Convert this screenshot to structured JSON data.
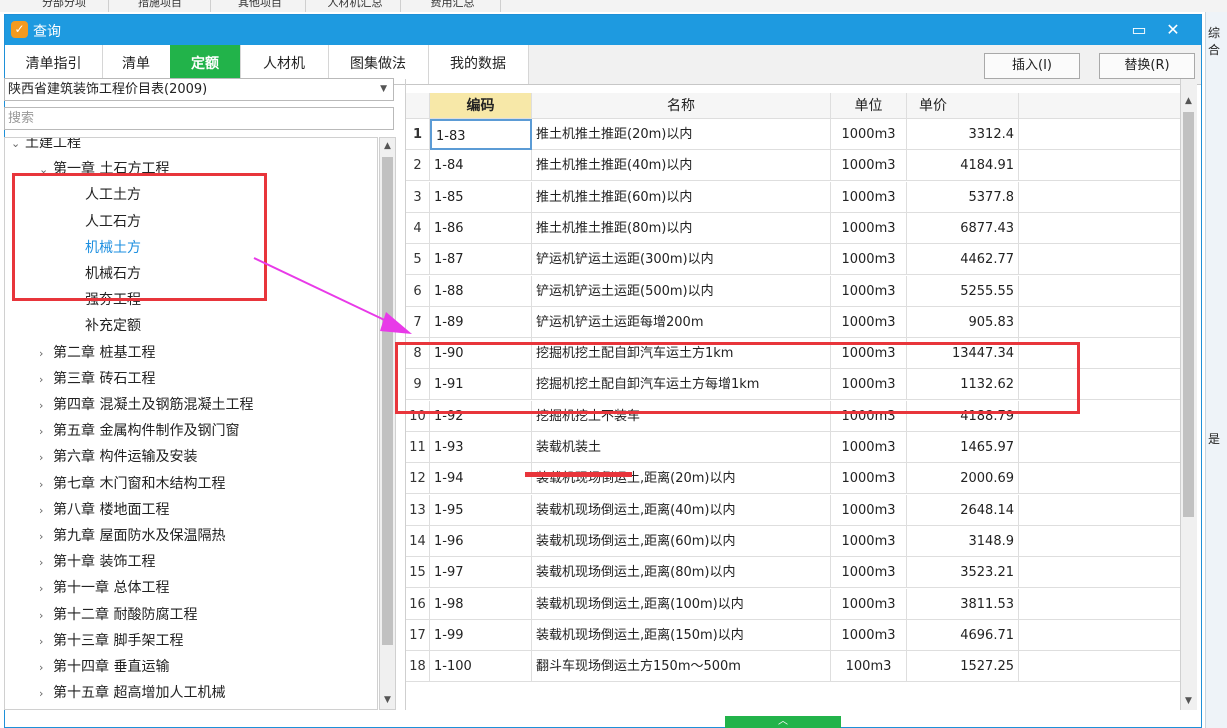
{
  "background": {
    "tabs": [
      "分部分项",
      "措施项目",
      "其他项目",
      "人材机汇总",
      "费用汇总"
    ],
    "right_cut_top": "综合",
    "right_cut_mid": "是"
  },
  "dialog": {
    "title": "查询",
    "minimize_icon": "minimize-icon",
    "close_icon": "close-icon",
    "tabs": [
      {
        "label": "清单指引",
        "active": false
      },
      {
        "label": "清单",
        "active": false
      },
      {
        "label": "定额",
        "active": true
      },
      {
        "label": "人材机",
        "active": false
      },
      {
        "label": "图集做法",
        "active": false
      },
      {
        "label": "我的数据",
        "active": false
      }
    ],
    "insert_button": "插入(I)",
    "replace_button": "替换(R)"
  },
  "left_panel": {
    "library_select": "陕西省建筑装饰工程价目表(2009)",
    "search_placeholder": "搜索",
    "tree": [
      {
        "label": "土建工程",
        "level": 0,
        "expanded": true
      },
      {
        "label": "第一章 土石方工程",
        "level": 1,
        "expanded": true
      },
      {
        "label": "人工土方",
        "level": 2
      },
      {
        "label": "人工石方",
        "level": 2
      },
      {
        "label": "机械土方",
        "level": 2,
        "selected": true
      },
      {
        "label": "机械石方",
        "level": 2
      },
      {
        "label": "强夯工程",
        "level": 2
      },
      {
        "label": "补充定额",
        "level": 2
      },
      {
        "label": "第二章 桩基工程",
        "level": 1,
        "expanded": false
      },
      {
        "label": "第三章 砖石工程",
        "level": 1,
        "expanded": false
      },
      {
        "label": "第四章 混凝土及钢筋混凝土工程",
        "level": 1,
        "expanded": false
      },
      {
        "label": "第五章 金属构件制作及钢门窗",
        "level": 1,
        "expanded": false
      },
      {
        "label": "第六章 构件运输及安装",
        "level": 1,
        "expanded": false
      },
      {
        "label": "第七章 木门窗和木结构工程",
        "level": 1,
        "expanded": false
      },
      {
        "label": "第八章 楼地面工程",
        "level": 1,
        "expanded": false
      },
      {
        "label": "第九章 屋面防水及保温隔热",
        "level": 1,
        "expanded": false
      },
      {
        "label": "第十章 装饰工程",
        "level": 1,
        "expanded": false
      },
      {
        "label": "第十一章 总体工程",
        "level": 1,
        "expanded": false
      },
      {
        "label": "第十二章 耐酸防腐工程",
        "level": 1,
        "expanded": false
      },
      {
        "label": "第十三章 脚手架工程",
        "level": 1,
        "expanded": false
      },
      {
        "label": "第十四章 垂直运输",
        "level": 1,
        "expanded": false
      },
      {
        "label": "第十五章 超高增加人工机械",
        "level": 1,
        "expanded": false
      }
    ]
  },
  "grid": {
    "columns": {
      "code": "编码",
      "name": "名称",
      "unit": "单位",
      "price": "单价"
    },
    "rows": [
      {
        "idx": "1",
        "code": "1-83",
        "name": "推土机推土推距(20m)以内",
        "unit": "1000m3",
        "price": "3312.4"
      },
      {
        "idx": "2",
        "code": "1-84",
        "name": "推土机推土推距(40m)以内",
        "unit": "1000m3",
        "price": "4184.91"
      },
      {
        "idx": "3",
        "code": "1-85",
        "name": "推土机推土推距(60m)以内",
        "unit": "1000m3",
        "price": "5377.8"
      },
      {
        "idx": "4",
        "code": "1-86",
        "name": "推土机推土推距(80m)以内",
        "unit": "1000m3",
        "price": "6877.43"
      },
      {
        "idx": "5",
        "code": "1-87",
        "name": "铲运机铲运土运距(300m)以内",
        "unit": "1000m3",
        "price": "4462.77"
      },
      {
        "idx": "6",
        "code": "1-88",
        "name": "铲运机铲运土运距(500m)以内",
        "unit": "1000m3",
        "price": "5255.55"
      },
      {
        "idx": "7",
        "code": "1-89",
        "name": "铲运机铲运土运距每增200m",
        "unit": "1000m3",
        "price": "905.83"
      },
      {
        "idx": "8",
        "code": "1-90",
        "name": "挖掘机挖土配自卸汽车运土方1km",
        "unit": "1000m3",
        "price": "13447.34"
      },
      {
        "idx": "9",
        "code": "1-91",
        "name": "挖掘机挖土配自卸汽车运土方每增1km",
        "unit": "1000m3",
        "price": "1132.62"
      },
      {
        "idx": "10",
        "code": "1-92",
        "name": "挖掘机挖土不装车",
        "unit": "1000m3",
        "price": "4188.79"
      },
      {
        "idx": "11",
        "code": "1-93",
        "name": "装载机装土",
        "unit": "1000m3",
        "price": "1465.97"
      },
      {
        "idx": "12",
        "code": "1-94",
        "name": "装载机现场倒运土,距离(20m)以内",
        "unit": "1000m3",
        "price": "2000.69"
      },
      {
        "idx": "13",
        "code": "1-95",
        "name": "装载机现场倒运土,距离(40m)以内",
        "unit": "1000m3",
        "price": "2648.14"
      },
      {
        "idx": "14",
        "code": "1-96",
        "name": "装载机现场倒运土,距离(60m)以内",
        "unit": "1000m3",
        "price": "3148.9"
      },
      {
        "idx": "15",
        "code": "1-97",
        "name": "装载机现场倒运土,距离(80m)以内",
        "unit": "1000m3",
        "price": "3523.21"
      },
      {
        "idx": "16",
        "code": "1-98",
        "name": "装载机现场倒运土,距离(100m)以内",
        "unit": "1000m3",
        "price": "3811.53"
      },
      {
        "idx": "17",
        "code": "1-99",
        "name": "装载机现场倒运土,距离(150m)以内",
        "unit": "1000m3",
        "price": "4696.71"
      },
      {
        "idx": "18",
        "code": "1-100",
        "name": "翻斗车现场倒运土方150m～500m",
        "unit": "100m3",
        "price": "1527.25"
      }
    ]
  },
  "colors": {
    "titlebar": "#1e9ae0",
    "active_tab": "#22b34a",
    "selected_tree_item": "#1e8fe0",
    "annotation_red": "#e8353b",
    "annotation_arrow": "#e83ae8",
    "code_header_fill": "#f7e8a8"
  }
}
